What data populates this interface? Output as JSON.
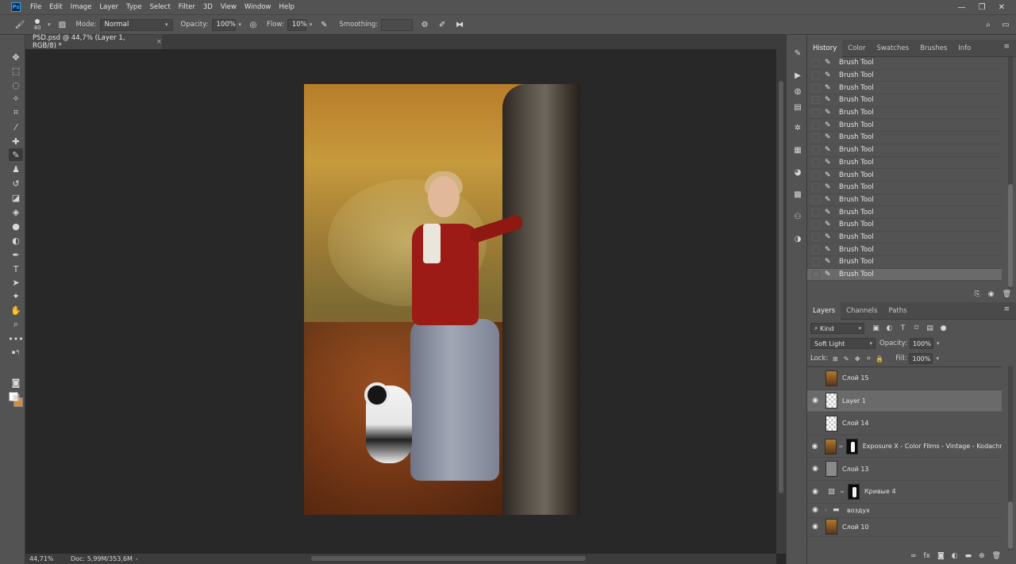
{
  "menubar": {
    "logo": "Ps",
    "items": [
      "File",
      "Edit",
      "Image",
      "Layer",
      "Type",
      "Select",
      "Filter",
      "3D",
      "View",
      "Window",
      "Help"
    ],
    "window_controls": [
      "—",
      "❐",
      "✕"
    ]
  },
  "options": {
    "brush_size": "40",
    "mode_label": "Mode:",
    "mode_value": "Normal",
    "opacity_label": "Opacity:",
    "opacity_value": "100%",
    "flow_label": "Flow:",
    "flow_value": "10%",
    "smoothing_label": "Smoothing:",
    "smoothing_value": ""
  },
  "document": {
    "tab_title": "PSD.psd @ 44,7% (Layer 1, RGB/8) *",
    "tab_close": "×"
  },
  "history": {
    "tabs": [
      "History",
      "Color",
      "Swatches",
      "Brushes",
      "Info"
    ],
    "items": [
      "Brush Tool",
      "Brush Tool",
      "Brush Tool",
      "Brush Tool",
      "Brush Tool",
      "Brush Tool",
      "Brush Tool",
      "Brush Tool",
      "Brush Tool",
      "Brush Tool",
      "Brush Tool",
      "Brush Tool",
      "Brush Tool",
      "Brush Tool",
      "Brush Tool",
      "Brush Tool",
      "Brush Tool",
      "Brush Tool"
    ]
  },
  "layers": {
    "tabs": [
      "Layers",
      "Channels",
      "Paths"
    ],
    "filter_kind": "Kind",
    "blend_mode": "Soft Light",
    "opacity_label": "Opacity:",
    "opacity_value": "100%",
    "lock_label": "Lock:",
    "fill_label": "Fill:",
    "fill_value": "100%",
    "rows": [
      {
        "name": "Слой 15"
      },
      {
        "name": "Layer 1"
      },
      {
        "name": "Слой 14"
      },
      {
        "name": "Exposure X - Color Films - Vintage - Kodachr..."
      },
      {
        "name": "Слой 13"
      },
      {
        "name": "Кривые 4"
      },
      {
        "name": "воздух"
      },
      {
        "name": "Слой 10"
      }
    ]
  },
  "status": {
    "zoom": "44,71%",
    "doc_size": "Doc: 5,99M/353,6M"
  },
  "colors": {
    "foreground": "#ffffff",
    "background": "#d58b3c"
  }
}
